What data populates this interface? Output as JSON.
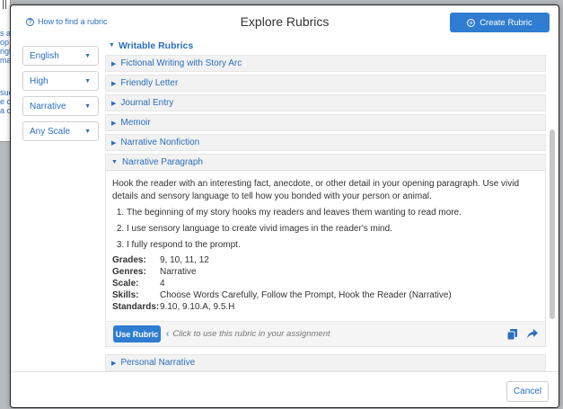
{
  "background": {
    "fragments": [
      "s ar",
      "op",
      "righ",
      "mai",
      "suc",
      "e c",
      "a c"
    ]
  },
  "header": {
    "help_link": "How to find a rubric",
    "title": "Explore Rubrics",
    "create_button": "Create Rubric"
  },
  "filters": [
    {
      "value": "English"
    },
    {
      "value": "High"
    },
    {
      "value": "Narrative"
    },
    {
      "value": "Any Scale"
    }
  ],
  "section": {
    "label": "Writable Rubrics"
  },
  "rubrics": [
    {
      "label": "Fictional Writing with Story Arc"
    },
    {
      "label": "Friendly Letter"
    },
    {
      "label": "Journal Entry"
    },
    {
      "label": "Memoir"
    },
    {
      "label": "Narrative Nonfiction"
    }
  ],
  "open_rubric": {
    "label": "Narrative Paragraph",
    "description": "Hook the reader with an interesting fact, anecdote, or other detail in your opening paragraph. Use vivid details and sensory language to tell how you bonded with your person or animal.",
    "criteria": [
      "The beginning of my story hooks my readers and leaves them wanting to read more.",
      "I use sensory language to create vivid images in the reader's mind.",
      "I fully respond to the prompt."
    ],
    "meta": {
      "grades_label": "Grades:",
      "grades": "9, 10, 11, 12",
      "genres_label": "Genres:",
      "genres": "Narrative",
      "scale_label": "Scale:",
      "scale": "4",
      "skills_label": "Skills:",
      "skills": "Choose Words Carefully, Follow the Prompt, Hook the Reader (Narrative)",
      "standards_label": "Standards:",
      "standards": "9.10, 9.10.A, 9.5.H"
    },
    "use_button": "Use Rubric",
    "hint": "Click to use this rubric in your assignment"
  },
  "next_rubric": {
    "label": "Personal Narrative"
  },
  "footer": {
    "cancel_button": "Cancel"
  },
  "colors": {
    "accent": "#2f7dd1",
    "link": "#2a6ebb"
  }
}
